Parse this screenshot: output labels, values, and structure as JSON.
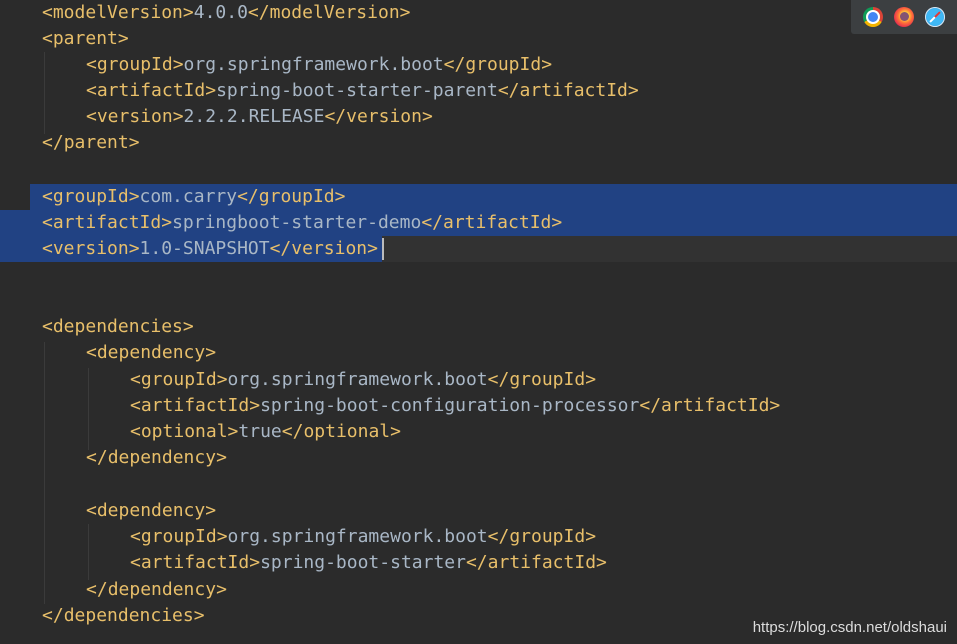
{
  "editor": {
    "lines": {
      "l01": {
        "open": "modelVersion",
        "text": "4.0.0",
        "close": "modelVersion"
      },
      "l02": {
        "open": "parent"
      },
      "l03": {
        "open": "groupId",
        "text": "org.springframework.boot",
        "close": "groupId"
      },
      "l04": {
        "open": "artifactId",
        "text": "spring-boot-starter-parent",
        "close": "artifactId"
      },
      "l05": {
        "open": "version",
        "text": "2.2.2.RELEASE",
        "close": "version"
      },
      "l06": {
        "close": "parent"
      },
      "l08": {
        "open": "groupId",
        "text": "com.carry",
        "close": "groupId"
      },
      "l09": {
        "open": "artifactId",
        "text": "springboot-starter-demo",
        "close": "artifactId"
      },
      "l10": {
        "open": "version",
        "text": "1.0-SNAPSHOT",
        "close": "version"
      },
      "l13": {
        "open": "dependencies"
      },
      "l14": {
        "open": "dependency"
      },
      "l15": {
        "open": "groupId",
        "text": "org.springframework.boot",
        "close": "groupId"
      },
      "l16": {
        "open": "artifactId",
        "text": "spring-boot-configuration-processor",
        "close": "artifactId"
      },
      "l17": {
        "open": "optional",
        "text": "true",
        "close": "optional"
      },
      "l18": {
        "close": "dependency"
      },
      "l20": {
        "open": "dependency"
      },
      "l21": {
        "open": "groupId",
        "text": "org.springframework.boot",
        "close": "groupId"
      },
      "l22": {
        "open": "artifactId",
        "text": "spring-boot-starter",
        "close": "artifactId"
      },
      "l23": {
        "close": "dependency"
      },
      "l24": {
        "close": "dependencies"
      }
    }
  },
  "browser_icons": [
    "chrome-icon",
    "firefox-icon",
    "safari-icon"
  ],
  "watermark": "https://blog.csdn.net/oldshaui",
  "colors": {
    "background": "#2b2b2b",
    "tag": "#e8bf6a",
    "text": "#a9b7c6",
    "selection": "#214283"
  }
}
